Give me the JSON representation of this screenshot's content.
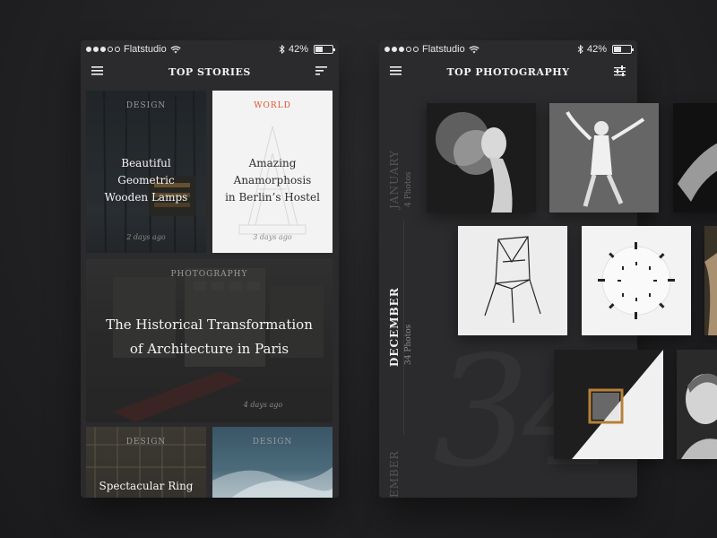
{
  "status": {
    "carrier": "Flatstudio",
    "battery": "42%"
  },
  "stories": {
    "title": "TOP STORIES",
    "cards": [
      {
        "category": "DESIGN",
        "title_line1": "Beautiful Geometric",
        "title_line2": "Wooden Lamps",
        "time": "2 days ago"
      },
      {
        "category": "WORLD",
        "title_line1": "Amazing Anamorphosis",
        "title_line2": "in Berlin’s Hostel",
        "time": "3 days ago"
      },
      {
        "category": "PHOTOGRAPHY",
        "title_line1": "The Historical Transformation",
        "title_line2": "of Architecture in Paris",
        "time": "4 days ago"
      },
      {
        "category": "DESIGN",
        "title_line1": "Spectacular Ring"
      },
      {
        "category": "DESIGN"
      }
    ]
  },
  "photography": {
    "title": "TOP PHOTOGRAPHY",
    "months": [
      {
        "name": "JANUARY",
        "count": "4 Photos"
      },
      {
        "name": "DECEMBER",
        "count": "34 Photos"
      },
      {
        "name": "EMBER"
      }
    ],
    "big_number": "34"
  },
  "colors": {
    "accent": "#e2522f",
    "background": "#1f1f21",
    "screen": "#2b2b2d"
  }
}
